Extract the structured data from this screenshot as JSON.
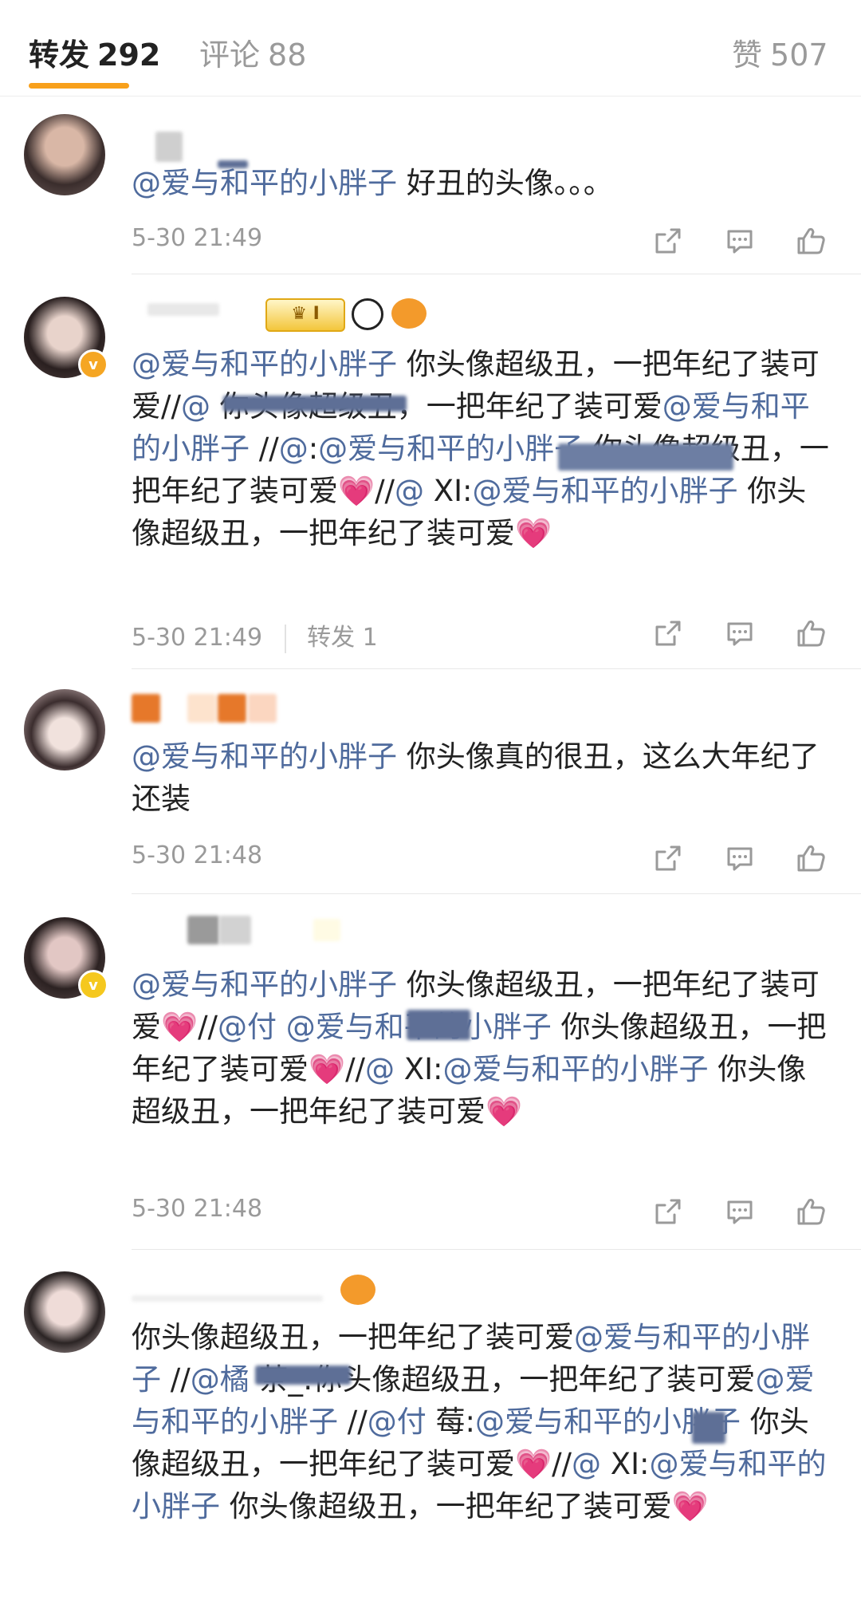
{
  "tabs": {
    "repost": {
      "label": "转发",
      "count": "292"
    },
    "comment": {
      "label": "评论",
      "count": "88"
    },
    "like": {
      "label": "赞",
      "count": "507"
    }
  },
  "posts": [
    {
      "segments": [
        {
          "t": "@爱与和平的小胖子",
          "m": true
        },
        {
          "t": " 好丑的头像。。。",
          "m": false
        }
      ],
      "time": "5-30 21:49",
      "reposts": null
    },
    {
      "segments": [
        {
          "t": "@爱与和平的小胖子",
          "m": true
        },
        {
          "t": " 你头像超级丑，一把年纪了装可爱//",
          "m": false
        },
        {
          "t": "@",
          "m": true
        },
        {
          "t": " 你头像超级丑，一把年纪了装可爱",
          "m": false
        },
        {
          "t": "@爱与和平的小胖子",
          "m": true
        },
        {
          "t": " //",
          "m": false
        },
        {
          "t": "@",
          "m": true
        },
        {
          "t": ":",
          "m": false
        },
        {
          "t": "@爱与和平的小胖子",
          "m": true
        },
        {
          "t": " 你头像超级丑，一把年纪了装可爱",
          "m": false
        },
        {
          "t": "💗",
          "h": true
        },
        {
          "t": "//",
          "m": false
        },
        {
          "t": "@",
          "m": true
        },
        {
          "t": " XI:",
          "m": false
        },
        {
          "t": "@爱与和平的小胖子",
          "m": true
        },
        {
          "t": " 你头像超级丑，一把年纪了装可爱",
          "m": false
        },
        {
          "t": "💗",
          "h": true
        }
      ],
      "time": "5-30 21:49",
      "reposts": "转发 1"
    },
    {
      "segments": [
        {
          "t": "@爱与和平的小胖子",
          "m": true
        },
        {
          "t": " 你头像真的很丑，这么大年纪了还装",
          "m": false
        }
      ],
      "time": "5-30 21:48",
      "reposts": null
    },
    {
      "segments": [
        {
          "t": "@爱与和平的小胖子",
          "m": true
        },
        {
          "t": " 你头像超级丑，一把年纪了装可爱",
          "m": false
        },
        {
          "t": "💗",
          "h": true
        },
        {
          "t": "//",
          "m": false
        },
        {
          "t": "@付",
          "m": true
        },
        {
          "t": " ",
          "m": false
        },
        {
          "t": "@爱与和平的小胖子",
          "m": true
        },
        {
          "t": " 你头像超级丑，一把年纪了装可爱",
          "m": false
        },
        {
          "t": "💗",
          "h": true
        },
        {
          "t": "//",
          "m": false
        },
        {
          "t": "@",
          "m": true
        },
        {
          "t": " XI:",
          "m": false
        },
        {
          "t": "@爱与和平的小胖子",
          "m": true
        },
        {
          "t": " 你头像超级丑，一把年纪了装可爱",
          "m": false
        },
        {
          "t": "💗",
          "h": true
        }
      ],
      "time": "5-30 21:48",
      "reposts": null
    },
    {
      "segments": [
        {
          "t": "你头像超级丑，一把年纪了装可爱",
          "m": false
        },
        {
          "t": "@爱与和平的小胖子",
          "m": true
        },
        {
          "t": " //",
          "m": false
        },
        {
          "t": "@橘",
          "m": true
        },
        {
          "t": " 茶_:你头像超级丑，一把年纪了装可爱",
          "m": false
        },
        {
          "t": "@爱与和平的小胖子",
          "m": true
        },
        {
          "t": " //",
          "m": false
        },
        {
          "t": "@付",
          "m": true
        },
        {
          "t": " 莓:",
          "m": false
        },
        {
          "t": "@爱与和平的小胖子",
          "m": true
        },
        {
          "t": " 你头像超级丑，一把年纪了装可爱",
          "m": false
        },
        {
          "t": "💗",
          "h": true
        },
        {
          "t": "//",
          "m": false
        },
        {
          "t": "@",
          "m": true
        },
        {
          "t": " XI:",
          "m": false
        },
        {
          "t": "@爱与和平的小胖子",
          "m": true
        },
        {
          "t": " 你头像超级丑，一把年纪了装可爱",
          "m": false
        },
        {
          "t": "💗",
          "h": true
        }
      ],
      "time": "",
      "reposts": null
    }
  ],
  "colors": {
    "accent": "#f8a01b",
    "mention": "#4f6b9d",
    "muted": "#9a9a9a"
  },
  "icons": [
    "share-icon",
    "comment-icon",
    "like-icon"
  ]
}
